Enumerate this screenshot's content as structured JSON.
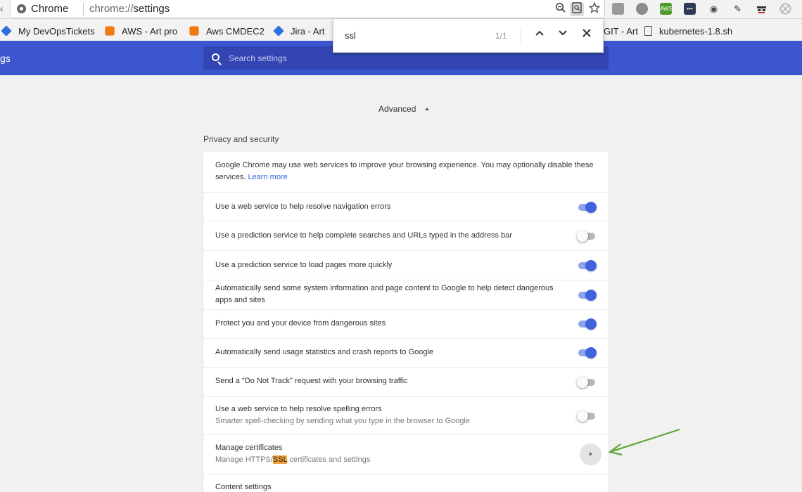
{
  "browser": {
    "site_name": "Chrome",
    "url_scheme": "chrome://",
    "url_path": "settings"
  },
  "bookmarks": [
    {
      "label": "My DevOpsTickets",
      "icon": "jira-diamond-icon"
    },
    {
      "label": "AWS - Art pro",
      "icon": "aws-cube-icon"
    },
    {
      "label": "Aws CMDEC2",
      "icon": "aws-cube-icon"
    },
    {
      "label": "Jira - Art",
      "icon": "jira-diamond-icon"
    },
    {
      "label": "GIT - Art",
      "icon": "none"
    },
    {
      "label": "kubernetes-1.8.sh",
      "icon": "file-icon"
    }
  ],
  "extensions": [
    {
      "name": "tab-extension-icon",
      "color": "#9a9a9a"
    },
    {
      "name": "gear-extension-icon",
      "color": "#8a8a8a"
    },
    {
      "name": "aws-extension-icon",
      "color": "#4e9a2c",
      "label": "AWS"
    },
    {
      "name": "dots-extension-icon",
      "color": "#2d3a55"
    },
    {
      "name": "eye-extension-icon",
      "color": "#444444"
    },
    {
      "name": "dropper-extension-icon",
      "color": "#333333"
    },
    {
      "name": "spy-extension-icon",
      "color": "#333333"
    },
    {
      "name": "globe-extension-icon",
      "color": "#b0b0b0"
    }
  ],
  "find_bar": {
    "query": "ssl",
    "count": "1/1"
  },
  "header": {
    "title_fragment": "gs",
    "search_placeholder": "Search settings"
  },
  "content": {
    "advanced_label": "Advanced",
    "section_title": "Privacy and security",
    "intro_text": "Google Chrome may use web services to improve your browsing experience. You may optionally disable these services.",
    "intro_link": "Learn more",
    "settings": [
      {
        "label": "Use a web service to help resolve navigation errors",
        "enabled": true
      },
      {
        "label": "Use a prediction service to help complete searches and URLs typed in the address bar",
        "enabled": false
      },
      {
        "label": "Use a prediction service to load pages more quickly",
        "enabled": true
      },
      {
        "label": "Automatically send some system information and page content to Google to help detect dangerous apps and sites",
        "enabled": true
      },
      {
        "label": "Protect you and your device from dangerous sites",
        "enabled": true
      },
      {
        "label": "Automatically send usage statistics and crash reports to Google",
        "enabled": true
      },
      {
        "label": "Send a \"Do Not Track\" request with your browsing traffic",
        "enabled": false
      },
      {
        "label": "Use a web service to help resolve spelling errors",
        "sublabel": "Smarter spell-checking by sending what you type in the browser to Google",
        "enabled": false
      }
    ],
    "manage_certificates": {
      "label": "Manage certificates",
      "sub_before": "Manage HTTPS/",
      "sub_highlight": "SSL",
      "sub_after": " certificates and settings"
    },
    "content_settings_label": "Content settings"
  },
  "colors": {
    "header_blue": "#3c56d0",
    "toggle_on": "#3e63dd",
    "find_highlight": "#f1a33b",
    "annotation_arrow": "#5aa832"
  }
}
